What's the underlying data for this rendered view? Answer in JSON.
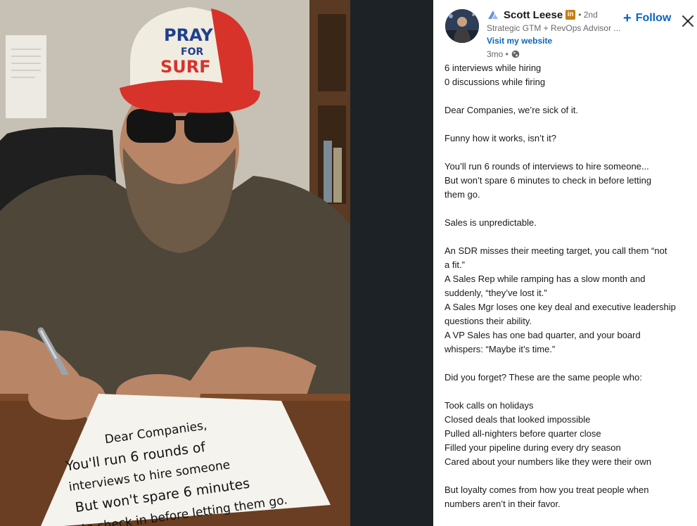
{
  "photo": {
    "hat_line1": "PRAY",
    "hat_line2": "FOR",
    "hat_line3": "SURF",
    "note_lines": [
      "Dear Companies,",
      "You'll run 6 rounds of",
      "interviews to hire someone",
      "But won't spare 6 minutes",
      "to check in before letting them go."
    ]
  },
  "author": {
    "name": "Scott Leese",
    "badge": "in",
    "degree": "• 2nd",
    "headline": "Strategic GTM + RevOps Advisor ...",
    "website_label": "Visit my website",
    "time": "3mo •"
  },
  "actions": {
    "follow_plus": "+",
    "follow_label": "Follow",
    "close_symbol": "✕"
  },
  "post": {
    "lines": [
      "6 interviews while hiring",
      "0 discussions while firing",
      "",
      "Dear Companies, we’re sick of it.",
      "",
      "Funny how it works, isn’t it?",
      "",
      "You’ll run 6 rounds of interviews to hire someone...",
      "But won’t spare 6 minutes to check in before letting",
      "them go.",
      "",
      "Sales is unpredictable.",
      "",
      "An SDR misses their meeting target, you call them “not",
      "a fit.”",
      "A Sales Rep while ramping has a slow month and",
      "suddenly, “they’ve lost it.”",
      "A Sales Mgr loses one key deal and executive leadership",
      "questions their ability.",
      "A VP Sales has one bad quarter, and your board",
      "whispers: “Maybe it’s time.”",
      "",
      "Did you forget? These are the same people who:",
      "",
      "Took calls on holidays",
      "Closed deals that looked impossible",
      "Pulled all-nighters before quarter close",
      "Filled your pipeline during every dry season",
      "Cared about your numbers like they were their own",
      "",
      "But loyalty comes from how you treat people when",
      "numbers aren’t in their favor."
    ]
  },
  "colors": {
    "link": "#0a66c2",
    "image_backdrop": "#1d2226",
    "badge": "#c37d16"
  }
}
